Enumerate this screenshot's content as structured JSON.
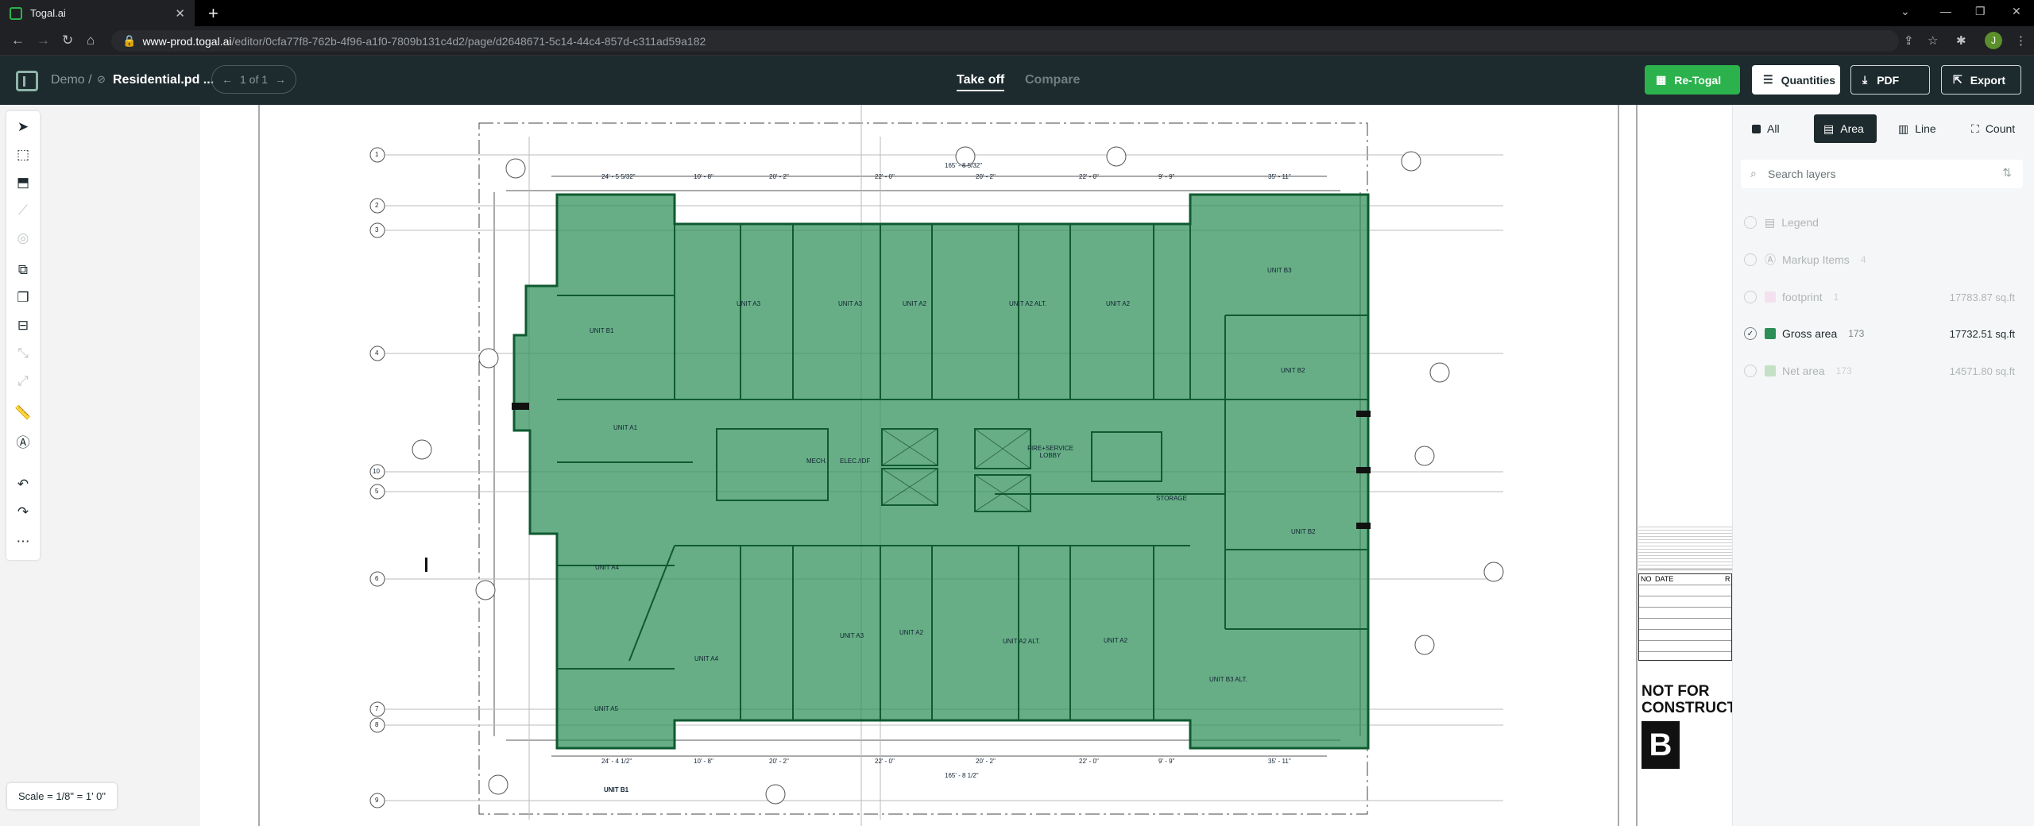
{
  "browser": {
    "tab_title": "Togal.ai",
    "url_host": "www-prod.togal.ai",
    "url_path": "/editor/0cfa77f8-762b-4f96-a1f0-7809b131c4d2/page/d2648671-5c14-44c4-857d-c311ad59a182",
    "profile_initial": "J"
  },
  "header": {
    "project": "Demo /",
    "filename": "Residential.pd ...",
    "pager": "1 of 1",
    "tabs": [
      "Take off",
      "Compare"
    ],
    "buttons": {
      "retogal": "Re-Togal",
      "quantities": "Quantities",
      "pdf": "PDF",
      "export": "Export"
    },
    "accent": "#2bb24c"
  },
  "panel": {
    "filters": [
      "All",
      "Area",
      "Line",
      "Count"
    ],
    "active_filter": "Area",
    "search_placeholder": "Search layers",
    "layers": [
      {
        "name": "Legend",
        "count": "",
        "value": ""
      },
      {
        "name": "Markup Items",
        "count": "4",
        "value": ""
      },
      {
        "name": "footprint",
        "count": "1",
        "value": "17783.87 sq.ft",
        "color": "#f4b7e0"
      },
      {
        "name": "Gross area",
        "count": "173",
        "value": "17732.51 sq.ft",
        "color": "#2d8f57"
      },
      {
        "name": "Net area",
        "count": "173",
        "value": "14571.80 sq.ft",
        "color": "#5fb85f"
      }
    ]
  },
  "plan": {
    "units": [
      "UNIT B1",
      "UNIT A3",
      "UNIT A3",
      "UNIT A2",
      "UNIT A2 ALT.",
      "UNIT A2",
      "UNIT B3",
      "UNIT B2",
      "UNIT A1",
      "MECH.",
      "ELEC./IDF",
      "FIRE+SERVICE LOBBY",
      "STORAGE",
      "UNIT B2",
      "UNIT A4",
      "UNIT A4",
      "UNIT A3",
      "UNIT A2",
      "UNIT A2 ALT.",
      "UNIT A2",
      "UNIT B3 ALT.",
      "UNIT A5",
      "UNIT B1"
    ],
    "dims_top": [
      "24' - 5 5/32\"",
      "10' - 8\"",
      "20' - 2\"",
      "22' - 0\"",
      "20' - 2\"",
      "22' - 0\"",
      "9' - 9\"",
      "35' - 11\""
    ],
    "total_top": "165' - 8 5/32\"",
    "dims_bottom": [
      "24' - 4 1/2\"",
      "10' - 8\"",
      "20' - 2\"",
      "22' - 0\"",
      "20' - 2\"",
      "22' - 0\"",
      "9' - 9\"",
      "35' - 11\""
    ],
    "total_bottom": "165' - 8 1/2\"",
    "grid_labels": [
      "1",
      "2",
      "3",
      "4",
      "10",
      "5",
      "6",
      "7",
      "8",
      "9"
    ],
    "title_block": {
      "col1": "NO",
      "col2": "DATE",
      "col3": "R",
      "stamp": "NOT FOR CONSTRUCTI",
      "firm": "B"
    }
  },
  "scale_label": "Scale = 1/8\" = 1' 0\"",
  "fill_color": "#2d8f57"
}
